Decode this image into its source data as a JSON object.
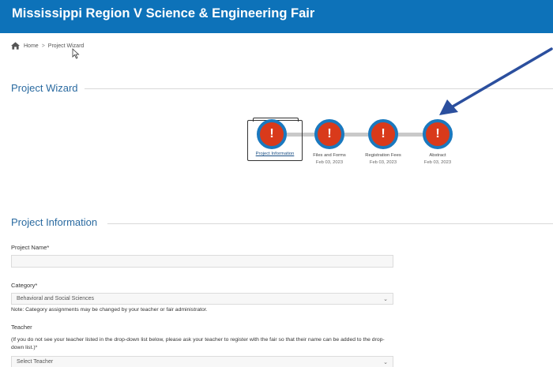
{
  "header": {
    "title": "Mississippi Region V Science & Engineering Fair"
  },
  "breadcrumb": {
    "home": "Home",
    "separator": ">",
    "current": "Project Wizard"
  },
  "wizard": {
    "heading": "Project Wizard",
    "steps": [
      {
        "icon": "!",
        "label": "Project Information",
        "date": ""
      },
      {
        "icon": "!",
        "label": "Files and Forms",
        "date": "Feb 03, 2023"
      },
      {
        "icon": "!",
        "label": "Registration Fees",
        "date": "Feb 03, 2023"
      },
      {
        "icon": "!",
        "label": "Abstract",
        "date": "Feb 03, 2023"
      }
    ]
  },
  "project_info": {
    "heading": "Project Information",
    "project_name_label": "Project Name*",
    "project_name_value": "",
    "category_label": "Category*",
    "category_value": "Behavioral and Social Sciences",
    "category_note": "Note: Category assignments may be changed by your teacher or fair administrator.",
    "teacher_label": "Teacher",
    "teacher_note": "(If you do not see your teacher listed in the drop-down list below, please ask your teacher to register with the fair so that their name can be added to the drop-down list.)*",
    "teacher_placeholder": "Select Teacher",
    "chevron": "⌄"
  },
  "colors": {
    "header_bg": "#0d72b9",
    "step_fill": "#d93a1b",
    "step_ring": "#1a79bf",
    "heading": "#2a6aa0",
    "annotation_arrow": "#2b4f9e"
  }
}
